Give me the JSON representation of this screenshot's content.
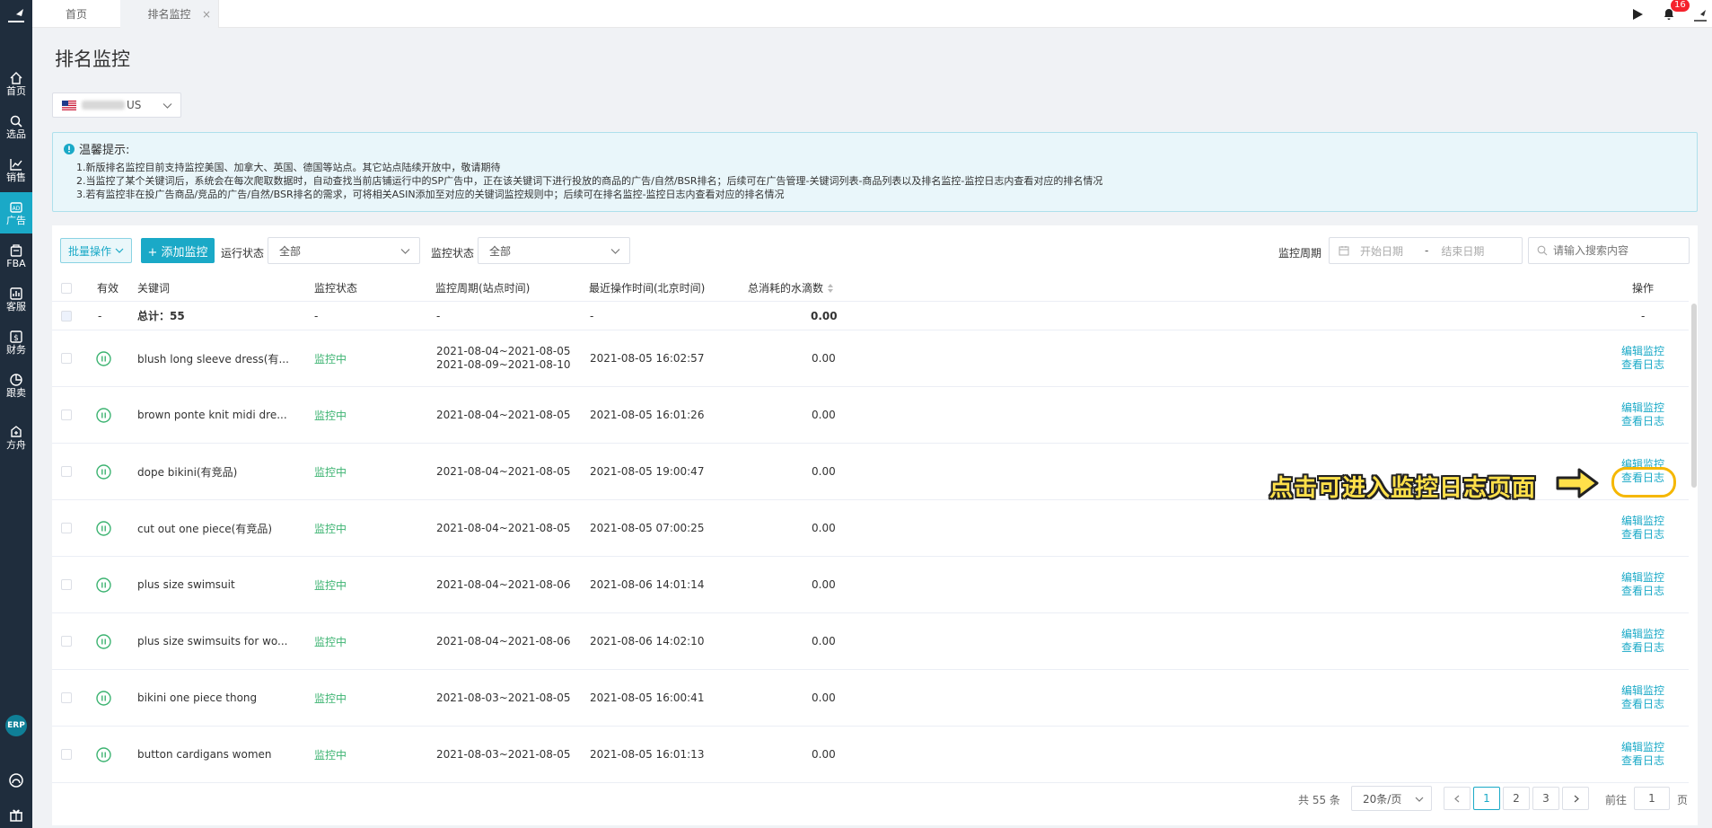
{
  "topbar": {
    "tabs": [
      {
        "label": "首页"
      },
      {
        "label": "排名监控",
        "close": "×"
      }
    ],
    "notification_count": "16"
  },
  "sidebar": {
    "items": [
      {
        "label": "首页",
        "icon": "home-icon"
      },
      {
        "label": "选品",
        "icon": "search-icon"
      },
      {
        "label": "销售",
        "icon": "chart-line-icon"
      },
      {
        "label": "广告",
        "icon": "ad-icon",
        "active": true
      },
      {
        "label": "FBA",
        "icon": "box-icon"
      },
      {
        "label": "客服",
        "icon": "bar-chart-icon"
      },
      {
        "label": "财务",
        "icon": "money-icon"
      },
      {
        "label": "跟卖",
        "icon": "pie-chart-icon"
      },
      {
        "label": "方舟",
        "icon": "ark-icon"
      }
    ],
    "erp_label": "ERP"
  },
  "page": {
    "title": "排名监控",
    "store_select": {
      "value": "US"
    }
  },
  "notice": {
    "title": "温馨提示:",
    "lines": [
      "1.新版排名监控目前支持监控美国、加拿大、英国、德国等站点。其它站点陆续开放中，敬请期待",
      "2.当监控了某个关键词后，系统会在每次爬取数据时，自动查找当前店铺运行中的SP广告中，正在该关键词下进行投放的商品的广告/自然/BSR排名；后续可在广告管理-关键词列表-商品列表以及排名监控-监控日志内查看对应的排名情况",
      "3.若有监控非在投广告商品/竞品的广告/自然/BSR排名的需求，可将相关ASIN添加至对应的关键词监控规则中；后续可在排名监控-监控日志内查看对应的排名情况"
    ]
  },
  "toolbar": {
    "batch_label": "批量操作",
    "add_label": "+ 添加监控",
    "run_status_label": "运行状态",
    "run_status_value": "全部",
    "monitor_status_label": "监控状态",
    "monitor_status_value": "全部",
    "period_label": "监控周期",
    "start_placeholder": "开始日期",
    "date_sep": "-",
    "end_placeholder": "结束日期",
    "search_placeholder": "请输入搜索内容"
  },
  "table": {
    "headers": {
      "valid": "有效",
      "keyword": "关键词",
      "status": "监控状态",
      "period": "监控周期(站点时间)",
      "last_op": "最近操作时间(北京时间)",
      "cost": "总消耗的水滴数",
      "ops": "操作"
    },
    "total": {
      "valid": "-",
      "keyword": "总计：55",
      "status": "-",
      "period": "-",
      "last_op": "-",
      "cost": "0.00",
      "ops": "-"
    },
    "rows": [
      {
        "keyword": "blush long sleeve dress(有...",
        "status": "监控中",
        "period": [
          "2021-08-04~2021-08-05",
          "2021-08-09~2021-08-10"
        ],
        "last_op": "2021-08-05 16:02:57",
        "cost": "0.00",
        "edit": "编辑监控",
        "log": "查看日志"
      },
      {
        "keyword": "brown ponte knit midi dre...",
        "status": "监控中",
        "period": [
          "2021-08-04~2021-08-05"
        ],
        "last_op": "2021-08-05 16:01:26",
        "cost": "0.00",
        "edit": "编辑监控",
        "log": "查看日志"
      },
      {
        "keyword": "dope bikini(有竞品)",
        "status": "监控中",
        "period": [
          "2021-08-04~2021-08-05"
        ],
        "last_op": "2021-08-05 19:00:47",
        "cost": "0.00",
        "edit": "编辑监控",
        "log": "查看日志"
      },
      {
        "keyword": "cut out one piece(有竞品)",
        "status": "监控中",
        "period": [
          "2021-08-04~2021-08-05"
        ],
        "last_op": "2021-08-05 07:00:25",
        "cost": "0.00",
        "edit": "编辑监控",
        "log": "查看日志"
      },
      {
        "keyword": "plus size swimsuit",
        "status": "监控中",
        "period": [
          "2021-08-04~2021-08-06"
        ],
        "last_op": "2021-08-06 14:01:14",
        "cost": "0.00",
        "edit": "编辑监控",
        "log": "查看日志"
      },
      {
        "keyword": "plus size swimsuits for wo...",
        "status": "监控中",
        "period": [
          "2021-08-04~2021-08-06"
        ],
        "last_op": "2021-08-06 14:02:10",
        "cost": "0.00",
        "edit": "编辑监控",
        "log": "查看日志"
      },
      {
        "keyword": "bikini one piece thong",
        "status": "监控中",
        "period": [
          "2021-08-03~2021-08-05"
        ],
        "last_op": "2021-08-05 16:00:41",
        "cost": "0.00",
        "edit": "编辑监控",
        "log": "查看日志"
      },
      {
        "keyword": "button cardigans women",
        "status": "监控中",
        "period": [
          "2021-08-03~2021-08-05"
        ],
        "last_op": "2021-08-05 16:01:13",
        "cost": "0.00",
        "edit": "编辑监控",
        "log": "查看日志"
      }
    ]
  },
  "pagination": {
    "total": "共 55 条",
    "page_size": "20条/页",
    "pages": [
      "1",
      "2",
      "3"
    ],
    "current": "1",
    "goto_label": "前往",
    "goto_value": "1",
    "page_suffix": "页"
  },
  "annotation": {
    "text": "点击可进入监控日志页面"
  },
  "colors": {
    "accent": "#1aa9c7",
    "sidebar": "#1f2d3d",
    "running": "#3cb371",
    "annotation": "#ffe04a"
  }
}
